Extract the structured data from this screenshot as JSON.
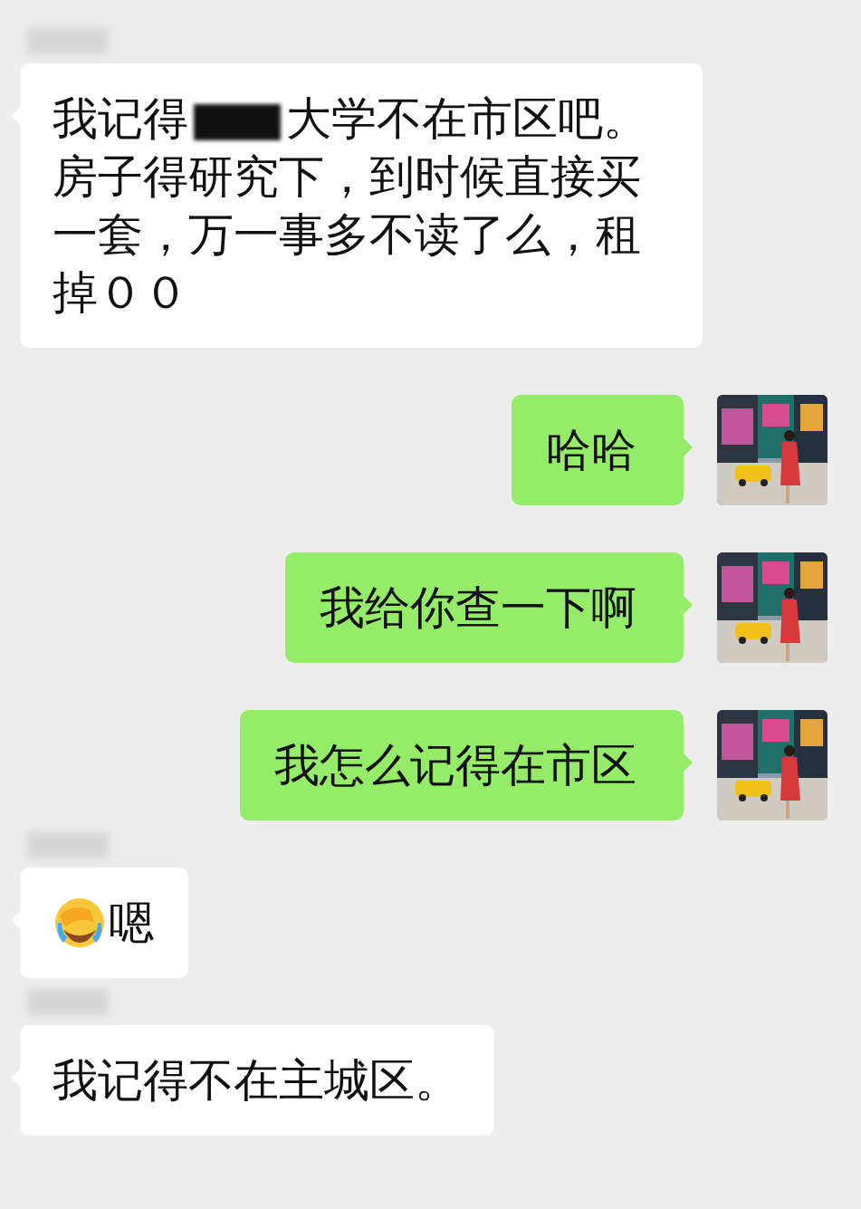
{
  "messages": [
    {
      "outgoing": false,
      "kind": "redacted",
      "name_blurred": true,
      "parts": [
        "我记得",
        "大学不在市区吧。房子得研究下，到时候直接买一套，万一事多不读了么，租掉００"
      ]
    },
    {
      "outgoing": true,
      "kind": "text",
      "text": "哈哈"
    },
    {
      "outgoing": true,
      "kind": "text",
      "text": "我给你查一下啊"
    },
    {
      "outgoing": true,
      "kind": "text",
      "text": "我怎么记得在市区"
    },
    {
      "outgoing": false,
      "kind": "emoji_text",
      "name_blurred": true,
      "text": "嗯"
    },
    {
      "outgoing": false,
      "kind": "text",
      "name_blurred": true,
      "text": "我记得不在主城区。"
    }
  ]
}
